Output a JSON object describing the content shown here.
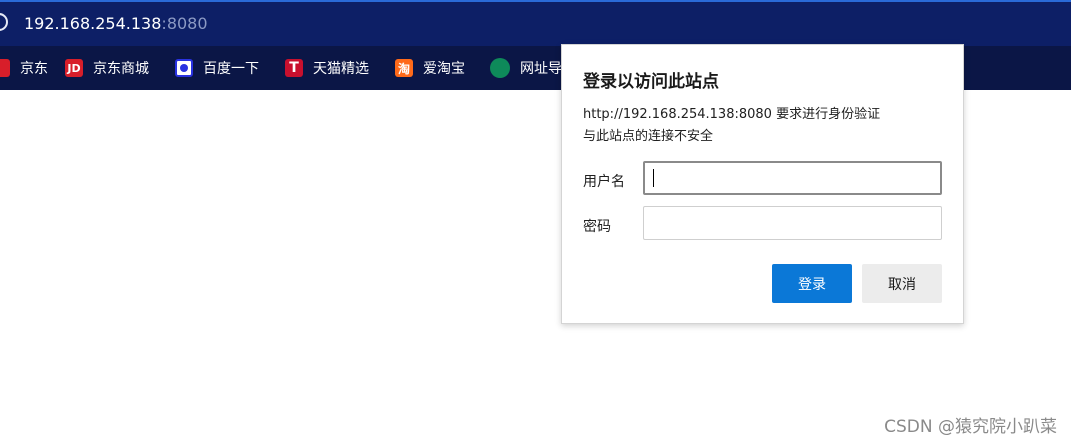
{
  "address_bar": {
    "host": "192.168.254.138",
    "port": ":8080",
    "icon": "info-icon"
  },
  "bookmarks": [
    {
      "label": "京东",
      "icon": "jd-icon",
      "icon_text": "",
      "color": "#d81e2a"
    },
    {
      "label": "京东商城",
      "icon": "jd-mall-icon",
      "icon_text": "JD",
      "color": "#d81e2a"
    },
    {
      "label": "百度一下",
      "icon": "baidu-icon",
      "icon_text": "",
      "color": "#2932e1"
    },
    {
      "label": "天猫精选",
      "icon": "tmall-icon",
      "icon_text": "T",
      "color": "#c8102e"
    },
    {
      "label": "爱淘宝",
      "icon": "taobao-icon",
      "icon_text": "淘",
      "color": "#ff6a1a"
    },
    {
      "label": "网址导",
      "icon": "web-nav-icon",
      "icon_text": "",
      "color": "#0e8a5a"
    }
  ],
  "dialog": {
    "title": "登录以访问此站点",
    "message_line1": "http://192.168.254.138:8080 要求进行身份验证",
    "message_line2": "与此站点的连接不安全",
    "username_label": "用户名",
    "username_value": "",
    "password_label": "密码",
    "password_value": "",
    "login_button": "登录",
    "cancel_button": "取消",
    "accent_color": "#0b78d7"
  },
  "watermark": "CSDN @猿究院小趴菜"
}
